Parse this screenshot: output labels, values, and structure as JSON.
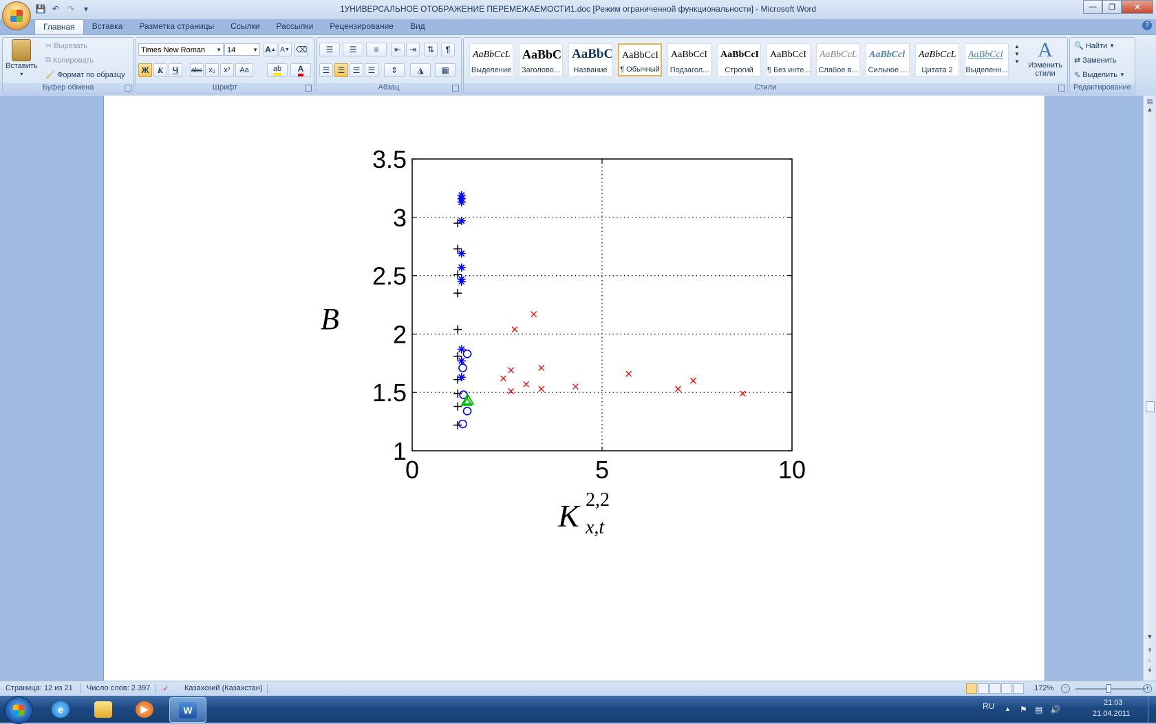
{
  "window": {
    "title": "1УНИВЕРСАЛЬНОЕ ОТОБРАЖЕНИЕ ПЕРЕМЕЖАЕМОСТИ1.doc [Режим ограниченной функциональности] - Microsoft Word"
  },
  "tabs": [
    "Главная",
    "Вставка",
    "Разметка страницы",
    "Ссылки",
    "Рассылки",
    "Рецензирование",
    "Вид"
  ],
  "clipboard": {
    "paste": "Вставить",
    "cut": "Вырезать",
    "copy": "Копировать",
    "format_painter": "Формат по образцу",
    "label": "Буфер обмена"
  },
  "font": {
    "name": "Times New Roman",
    "size": "14",
    "label": "Шрифт",
    "bold": "Ж",
    "italic": "К",
    "underline": "Ч",
    "strike": "abc",
    "sub": "x₂",
    "sup": "x²",
    "case": "Aa",
    "grow": "A",
    "shrink": "A",
    "color": "A"
  },
  "paragraph": {
    "label": "Абзац",
    "pilcrow": "¶"
  },
  "styles": {
    "label": "Стили",
    "items": [
      {
        "sample": "AaBbCcL",
        "name": "Выделение"
      },
      {
        "sample": "AaBbC",
        "name": "Заголово..."
      },
      {
        "sample": "AaBbC",
        "name": "Название"
      },
      {
        "sample": "AaBbCcI",
        "name": "¶ Обычный"
      },
      {
        "sample": "AaBbCcI",
        "name": "Подзагол..."
      },
      {
        "sample": "AaBbCcI",
        "name": "Строгий"
      },
      {
        "sample": "AaBbCcI",
        "name": "¶ Без инте..."
      },
      {
        "sample": "AaBbCcL",
        "name": "Слабое в..."
      },
      {
        "sample": "AaBbCcl",
        "name": "Сильное ..."
      },
      {
        "sample": "AaBbCcL",
        "name": "Цитата 2"
      },
      {
        "sample": "AaBbCcl",
        "name": "Выделенн..."
      }
    ],
    "change": "Изменить стили"
  },
  "editing": {
    "label": "Редактирование",
    "find": "Найти",
    "replace": "Заменить",
    "select": "Выделить"
  },
  "chart_data": {
    "type": "scatter",
    "xlim": [
      0,
      10
    ],
    "ylim": [
      1,
      3.5
    ],
    "xticks": [
      "0",
      "5",
      "10"
    ],
    "yticks": [
      "1",
      "1.5",
      "2",
      "2.5",
      "3",
      "3.5"
    ],
    "ylabel": "B",
    "xlabel": "K",
    "xlabel_sup": "2,2",
    "xlabel_sub": "x,t",
    "grid": true,
    "series": [
      {
        "marker": "plus",
        "color": "#000000",
        "points": [
          [
            1.2,
            2.95
          ],
          [
            1.2,
            2.73
          ],
          [
            1.2,
            2.51
          ],
          [
            1.2,
            2.35
          ],
          [
            1.2,
            2.04
          ],
          [
            1.2,
            1.81
          ],
          [
            1.2,
            1.61
          ],
          [
            1.2,
            1.49
          ],
          [
            1.2,
            1.38
          ],
          [
            1.2,
            1.22
          ]
        ]
      },
      {
        "marker": "star",
        "color": "#0000ff",
        "points": [
          [
            1.3,
            3.19
          ],
          [
            1.3,
            3.16
          ],
          [
            1.3,
            3.13
          ],
          [
            1.3,
            2.97
          ],
          [
            1.3,
            2.69
          ],
          [
            1.3,
            2.57
          ],
          [
            1.3,
            2.47
          ],
          [
            1.3,
            2.45
          ],
          [
            1.3,
            1.87
          ],
          [
            1.3,
            1.77
          ],
          [
            1.3,
            1.63
          ]
        ]
      },
      {
        "marker": "circle",
        "color": "#0000ff",
        "points": [
          [
            1.45,
            1.83
          ],
          [
            1.33,
            1.71
          ],
          [
            1.35,
            1.48
          ],
          [
            1.45,
            1.34
          ],
          [
            1.33,
            1.23
          ]
        ]
      },
      {
        "marker": "triangle",
        "color": "#00c000",
        "points": [
          [
            1.48,
            1.43
          ],
          [
            1.43,
            1.42
          ]
        ]
      },
      {
        "marker": "x",
        "color": "#ff0000",
        "points": [
          [
            2.4,
            1.62
          ],
          [
            2.6,
            1.51
          ],
          [
            2.6,
            1.69
          ],
          [
            2.7,
            2.04
          ],
          [
            3.0,
            1.57
          ],
          [
            3.2,
            2.17
          ],
          [
            3.4,
            1.53
          ],
          [
            3.4,
            1.71
          ],
          [
            4.3,
            1.55
          ],
          [
            5.7,
            1.66
          ],
          [
            7.0,
            1.53
          ],
          [
            7.4,
            1.6
          ],
          [
            8.7,
            1.49
          ]
        ]
      }
    ]
  },
  "status": {
    "page": "Страница: 12 из 21",
    "words": "Число слов: 2 397",
    "language": "Казахский (Казахстан)",
    "zoom": "172%"
  },
  "taskbar": {
    "lang": "RU",
    "time": "21:03",
    "date": "21.04.2011"
  },
  "colors": {
    "accent": "#1e395b",
    "ribbon": "#dae6f5"
  }
}
